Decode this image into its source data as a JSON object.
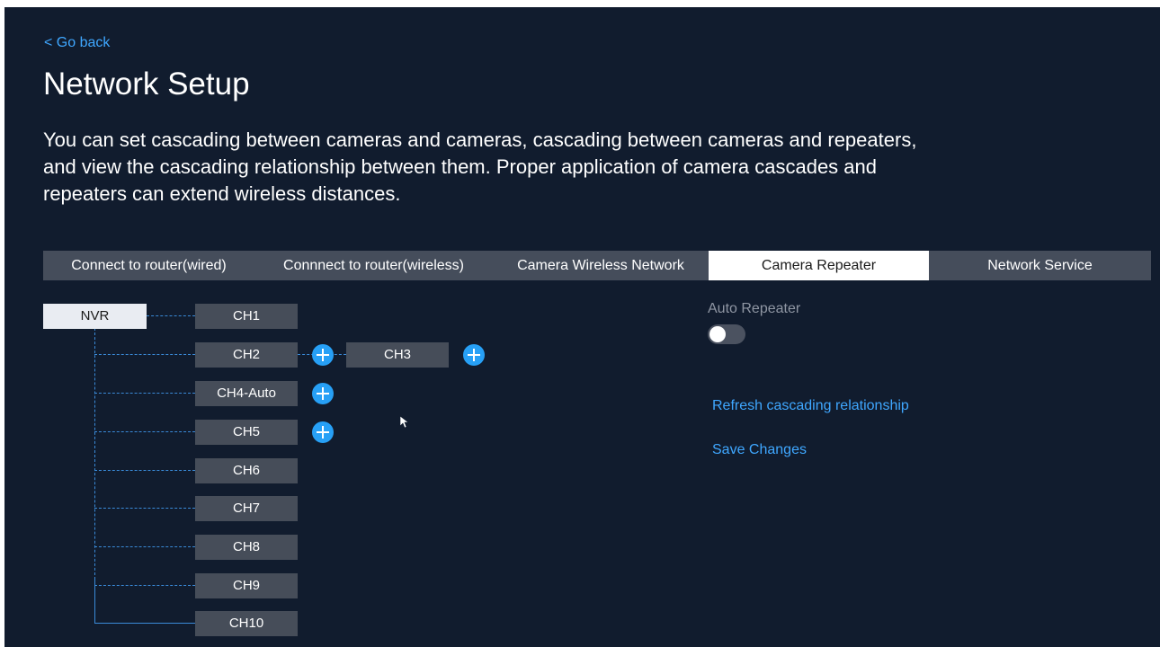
{
  "nav": {
    "back_label": "< Go back"
  },
  "page": {
    "title": "Network Setup",
    "description": "You can set cascading between cameras and cameras, cascading between cameras and repeaters, and view the cascading relationship between them. Proper application of camera cascades and repeaters can extend wireless distances."
  },
  "tabs": [
    {
      "label": "Connect to router(wired)",
      "active": false
    },
    {
      "label": "Connnect to router(wireless)",
      "active": false
    },
    {
      "label": "Camera Wireless Network",
      "active": false
    },
    {
      "label": "Camera Repeater",
      "active": true
    },
    {
      "label": "Network Service",
      "active": false
    }
  ],
  "topology": {
    "root": "NVR",
    "channels": [
      "CH1",
      "CH2",
      "CH4-Auto",
      "CH5",
      "CH6",
      "CH7",
      "CH8",
      "CH9",
      "CH10"
    ],
    "cascade": {
      "parent": "CH2",
      "child": "CH3"
    }
  },
  "side_panel": {
    "auto_repeater_label": "Auto Repeater",
    "auto_repeater_enabled": false,
    "refresh_label": "Refresh cascading relationship",
    "save_label": "Save Changes"
  },
  "colors": {
    "background": "#111c2e",
    "accent": "#27a0f6",
    "link": "#3fa7ff",
    "node": "#464d59",
    "tab_bar": "#454d5b"
  },
  "icons": {
    "add": "plus-circle-icon",
    "pointer": "mouse-cursor-icon"
  }
}
